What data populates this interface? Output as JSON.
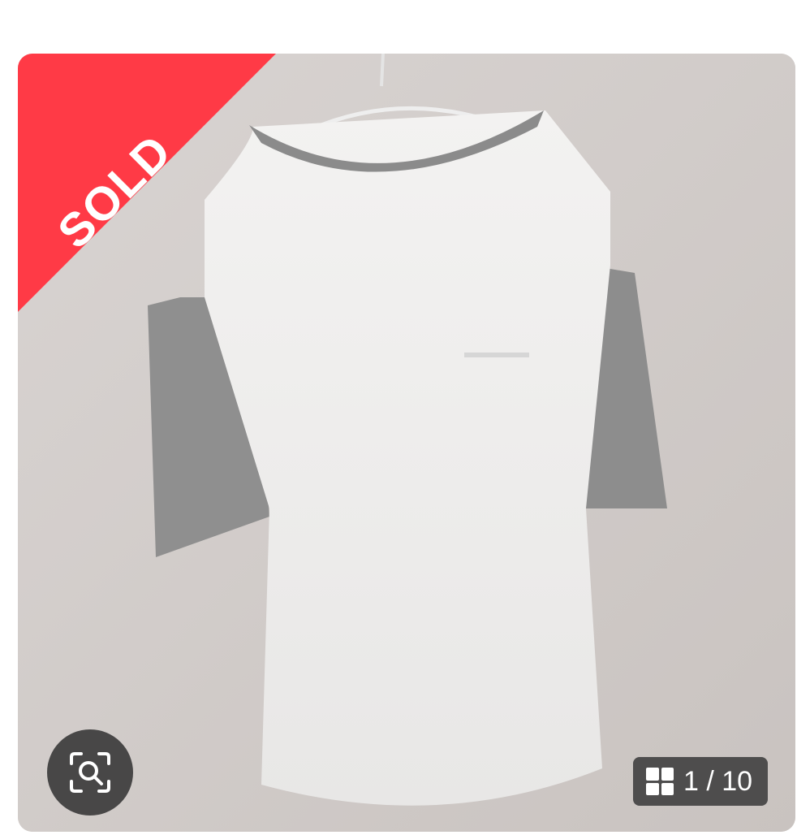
{
  "listing": {
    "badge_text": "SOLD",
    "image_counter": "1 / 10"
  },
  "icons": {
    "zoom": "zoom-search-icon",
    "gallery": "gallery-grid-icon"
  },
  "colors": {
    "sold_ribbon": "#ff3a46"
  }
}
